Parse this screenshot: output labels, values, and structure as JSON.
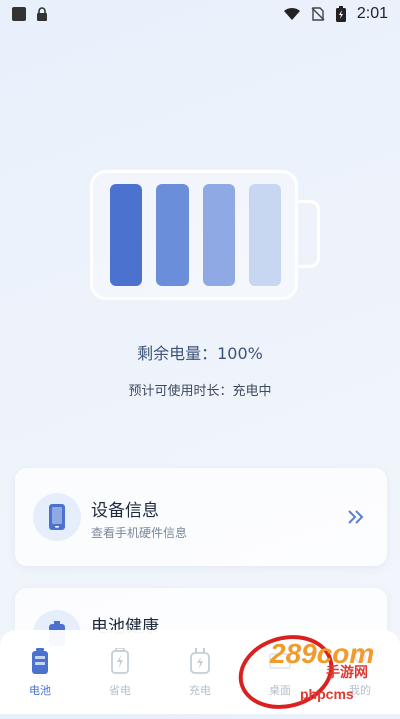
{
  "status_bar": {
    "time": "2:01",
    "icons": [
      "notification-square-icon",
      "lock-icon",
      "wifi-icon",
      "no-sim-icon",
      "battery-charging-icon"
    ]
  },
  "battery_visual": {
    "level_percent": 100,
    "colors": [
      "#4b72cf",
      "#6a8ed9",
      "#8ea9e3",
      "#c7d6f1"
    ]
  },
  "battery_info": {
    "remaining_label": "剩余电量：100%",
    "estimate_label": "预计可使用时长：充电中"
  },
  "cards": [
    {
      "title": "设备信息",
      "subtitle": "查看手机硬件信息",
      "icon": "phone-icon",
      "action_icon": "double-chevron-right-icon"
    },
    {
      "title": "电池健康",
      "icon": "battery-health-icon"
    }
  ],
  "tabs": [
    {
      "label": "电池",
      "icon": "battery-icon",
      "active": true
    },
    {
      "label": "省电",
      "icon": "battery-save-icon",
      "active": false
    },
    {
      "label": "充电",
      "icon": "charger-icon",
      "active": false
    },
    {
      "label": "桌面",
      "icon": "desktop-icon",
      "active": false
    },
    {
      "label": "我的",
      "icon": "profile-icon",
      "active": false
    }
  ],
  "watermark": {
    "logo": "289com",
    "sub": "手游网",
    "url": "phpcms"
  },
  "accent_color": "#4b72cf"
}
